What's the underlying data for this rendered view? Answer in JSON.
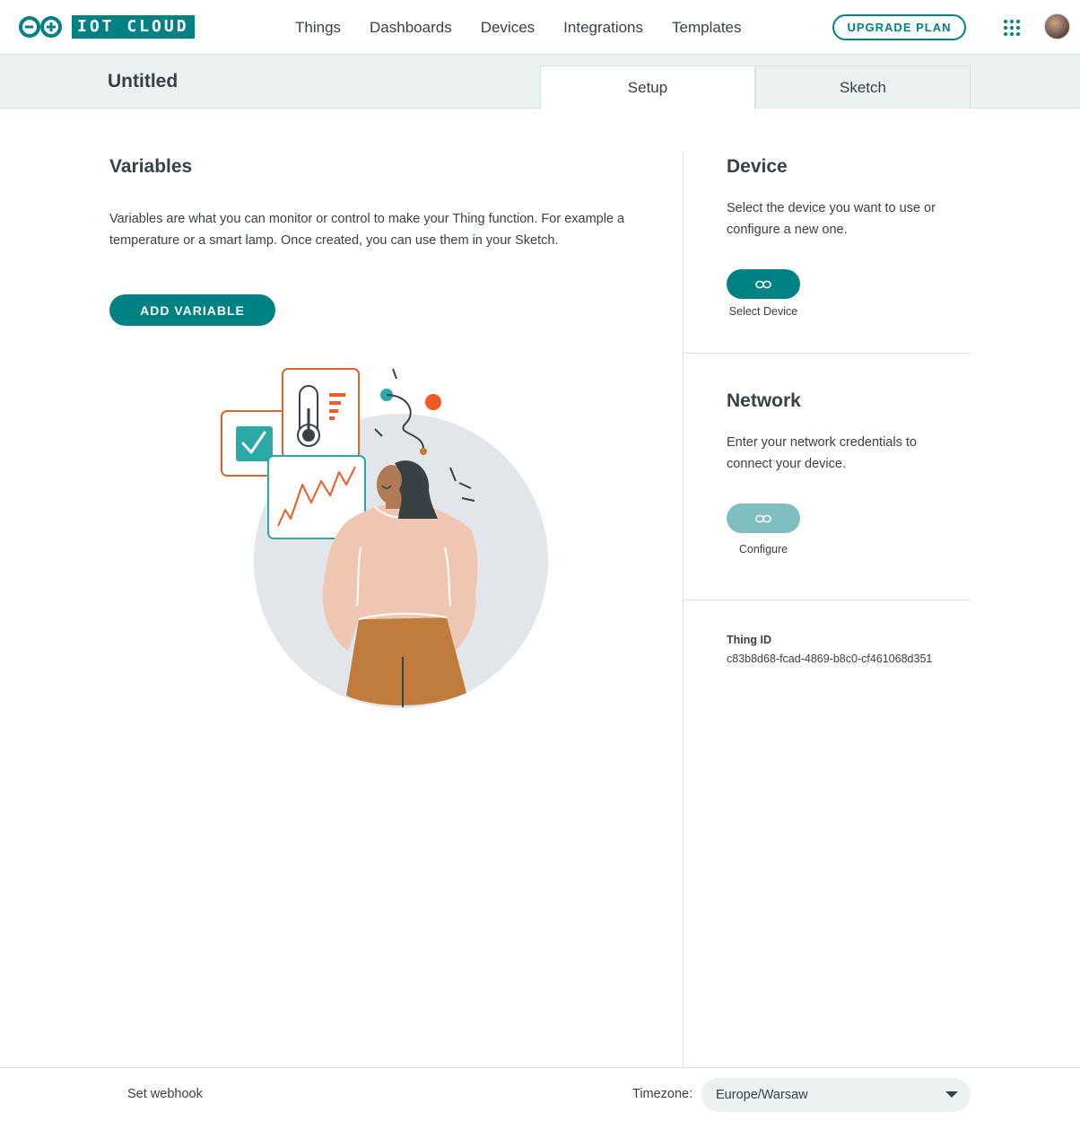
{
  "brand": {
    "logo_text": "IOT CLOUD",
    "accent_color": "#008184"
  },
  "nav": {
    "items": [
      "Things",
      "Dashboards",
      "Devices",
      "Integrations",
      "Templates"
    ],
    "upgrade_label": "UPGRADE PLAN",
    "apps_icon": "apps-grid-icon",
    "avatar_icon": "user-avatar"
  },
  "thing": {
    "title": "Untitled",
    "tabs": [
      "Setup",
      "Sketch"
    ],
    "active_tab": "Setup"
  },
  "variables": {
    "title": "Variables",
    "description": "Variables are what you can monitor or control to make your Thing function. For example a temperature or a smart lamp. Once created, you can use them in your Sketch.",
    "add_label": "ADD VARIABLE"
  },
  "device": {
    "title": "Device",
    "description": "Select the device you want to use or configure a new one.",
    "button_icon": "link-icon",
    "button_caption": "Select Device"
  },
  "network": {
    "title": "Network",
    "description": "Enter your network credentials to connect your device.",
    "button_icon": "link-icon",
    "button_caption": "Configure"
  },
  "thing_id": {
    "label": "Thing ID",
    "value": "c83b8d68-fcad-4869-b8c0-cf461068d351"
  },
  "footer": {
    "webhook_label": "Set webhook",
    "timezone_label": "Timezone:",
    "timezone_value": "Europe/Warsaw"
  }
}
